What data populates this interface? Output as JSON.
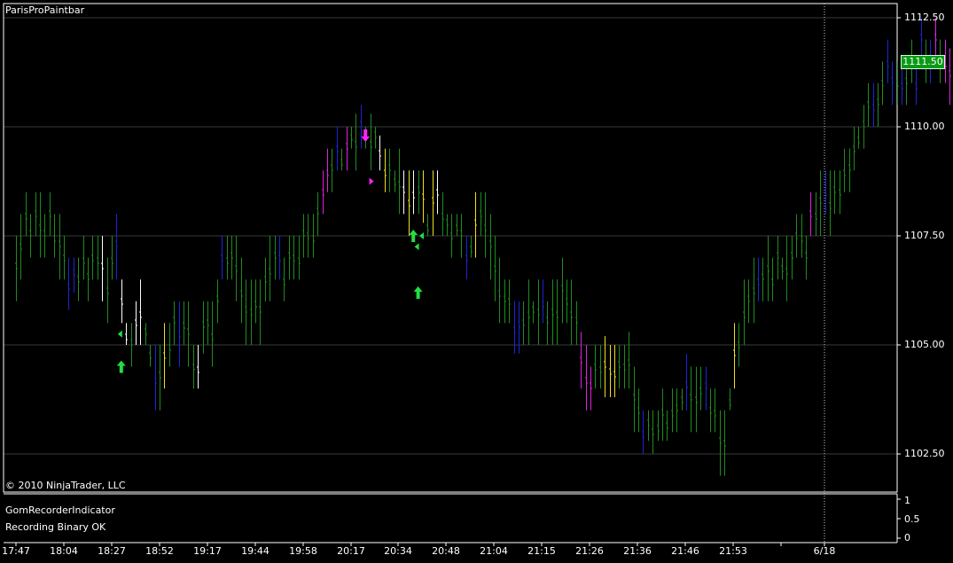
{
  "header": {
    "indicator_title": "ParisProPaintbar",
    "copyright": "© 2010 NinjaTrader, LLC"
  },
  "lower_panel": {
    "indicator_name": "GomRecorderIndicator",
    "status_text": "Recording Binary OK",
    "axis_labels": [
      "1",
      "0.5",
      "0"
    ]
  },
  "current_price": "1111.50",
  "chart_data": {
    "type": "bar",
    "style": "ohlc-price-bars",
    "title": "",
    "xlabel": "",
    "ylabel": "",
    "ylim": [
      1101.6,
      1112.9
    ],
    "grid": true,
    "y_ticks": [
      "1112.50",
      "1110.00",
      "1107.50",
      "1105.00",
      "1102.50"
    ],
    "x_ticks": [
      "17:47",
      "18:04",
      "18:27",
      "18:52",
      "19:17",
      "19:44",
      "19:58",
      "20:17",
      "20:34",
      "20:48",
      "21:04",
      "21:15",
      "21:26",
      "21:36",
      "21:46",
      "21:53",
      "6/18"
    ],
    "bar_colors": {
      "G": "#1e8c1e",
      "B": "#2222d8",
      "M": "#e020e0",
      "Y": "#f0e020",
      "W": "#ffffff"
    },
    "bars": [
      [
        "G",
        1107.5,
        1106.0
      ],
      [
        "G",
        1108.0,
        1106.5
      ],
      [
        "G",
        1108.5,
        1107.5
      ],
      [
        "G",
        1108.0,
        1107.0
      ],
      [
        "G",
        1108.5,
        1107.5
      ],
      [
        "G",
        1108.5,
        1107.0
      ],
      [
        "G",
        1108.0,
        1107.0
      ],
      [
        "G",
        1108.5,
        1107.5
      ],
      [
        "G",
        1108.0,
        1107.0
      ],
      [
        "G",
        1108.0,
        1106.5
      ],
      [
        "G",
        1107.5,
        1106.5
      ],
      [
        "B",
        1107.0,
        1105.8
      ],
      [
        "B",
        1107.0,
        1106.2
      ],
      [
        "G",
        1107.0,
        1106.0
      ],
      [
        "G",
        1107.5,
        1106.5
      ],
      [
        "G",
        1107.0,
        1106.0
      ],
      [
        "G",
        1107.5,
        1106.5
      ],
      [
        "G",
        1107.5,
        1106.5
      ],
      [
        "W",
        1107.5,
        1106.0
      ],
      [
        "G",
        1107.0,
        1105.5
      ],
      [
        "G",
        1107.5,
        1106.5
      ],
      [
        "B",
        1108.0,
        1106.5
      ],
      [
        "W",
        1106.5,
        1105.5
      ],
      [
        "W",
        1105.5,
        1105.0
      ],
      [
        "G",
        1105.5,
        1104.5
      ],
      [
        "W",
        1106.0,
        1105.0
      ],
      [
        "W",
        1106.5,
        1105.0
      ],
      [
        "G",
        1105.5,
        1105.0
      ],
      [
        "G",
        1105.0,
        1104.5
      ],
      [
        "B",
        1105.0,
        1103.5
      ],
      [
        "G",
        1105.0,
        1103.5
      ],
      [
        "Y",
        1105.5,
        1104.0
      ],
      [
        "G",
        1105.5,
        1104.5
      ],
      [
        "G",
        1106.0,
        1105.0
      ],
      [
        "B",
        1106.0,
        1104.5
      ],
      [
        "G",
        1106.0,
        1105.0
      ],
      [
        "G",
        1106.0,
        1104.5
      ],
      [
        "G",
        1105.0,
        1104.0
      ],
      [
        "W",
        1105.0,
        1104.0
      ],
      [
        "G",
        1106.0,
        1104.8
      ],
      [
        "G",
        1106.0,
        1105.0
      ],
      [
        "G",
        1106.0,
        1104.5
      ],
      [
        "G",
        1106.5,
        1105.5
      ],
      [
        "B",
        1107.5,
        1106.5
      ],
      [
        "G",
        1107.5,
        1106.5
      ],
      [
        "G",
        1107.5,
        1106.5
      ],
      [
        "G",
        1107.5,
        1106.0
      ],
      [
        "G",
        1107.0,
        1105.5
      ],
      [
        "G",
        1106.5,
        1105.0
      ],
      [
        "G",
        1106.5,
        1105.0
      ],
      [
        "G",
        1106.5,
        1105.5
      ],
      [
        "G",
        1106.5,
        1105.0
      ],
      [
        "G",
        1107.0,
        1106.0
      ],
      [
        "G",
        1107.5,
        1106.0
      ],
      [
        "G",
        1107.5,
        1106.5
      ],
      [
        "B",
        1107.5,
        1106.5
      ],
      [
        "G",
        1107.0,
        1106.0
      ],
      [
        "G",
        1107.5,
        1106.5
      ],
      [
        "G",
        1107.5,
        1106.5
      ],
      [
        "G",
        1107.5,
        1106.5
      ],
      [
        "G",
        1108.0,
        1107.0
      ],
      [
        "G",
        1108.0,
        1107.0
      ],
      [
        "G",
        1108.0,
        1107.0
      ],
      [
        "G",
        1108.5,
        1107.5
      ],
      [
        "M",
        1109.0,
        1108.0
      ],
      [
        "M",
        1109.5,
        1108.5
      ],
      [
        "G",
        1109.5,
        1108.5
      ],
      [
        "B",
        1110.0,
        1109.0
      ],
      [
        "G",
        1109.5,
        1109.0
      ],
      [
        "M",
        1110.0,
        1109.0
      ],
      [
        "G",
        1110.0,
        1109.5
      ],
      [
        "G",
        1110.3,
        1109.0
      ],
      [
        "B",
        1110.5,
        1109.5
      ],
      [
        "G",
        1110.0,
        1109.5
      ],
      [
        "G",
        1110.3,
        1109.0
      ],
      [
        "G",
        1110.0,
        1109.5
      ],
      [
        "W",
        1109.8,
        1109.0
      ],
      [
        "Y",
        1109.5,
        1108.5
      ],
      [
        "G",
        1109.5,
        1108.5
      ],
      [
        "G",
        1109.0,
        1108.5
      ],
      [
        "G",
        1109.5,
        1108.0
      ],
      [
        "W",
        1109.0,
        1108.0
      ],
      [
        "Y",
        1109.0,
        1107.5
      ],
      [
        "W",
        1109.0,
        1108.0
      ],
      [
        "G",
        1109.0,
        1108.0
      ],
      [
        "Y",
        1109.0,
        1107.8
      ],
      [
        "G",
        1108.0,
        1107.5
      ],
      [
        "Y",
        1109.0,
        1107.5
      ],
      [
        "W",
        1109.0,
        1108.0
      ],
      [
        "G",
        1108.5,
        1107.5
      ],
      [
        "G",
        1108.0,
        1107.5
      ],
      [
        "G",
        1108.0,
        1107.0
      ],
      [
        "G",
        1108.0,
        1107.5
      ],
      [
        "G",
        1108.0,
        1107.0
      ],
      [
        "B",
        1107.5,
        1106.5
      ],
      [
        "G",
        1107.5,
        1107.0
      ],
      [
        "Y",
        1108.5,
        1107.0
      ],
      [
        "G",
        1108.5,
        1107.5
      ],
      [
        "G",
        1108.5,
        1107.0
      ],
      [
        "G",
        1108.0,
        1106.5
      ],
      [
        "G",
        1107.5,
        1106.0
      ],
      [
        "G",
        1107.0,
        1105.5
      ],
      [
        "G",
        1106.5,
        1105.5
      ],
      [
        "G",
        1106.5,
        1105.5
      ],
      [
        "B",
        1106.0,
        1104.8
      ],
      [
        "B",
        1106.0,
        1104.8
      ],
      [
        "G",
        1106.0,
        1105.0
      ],
      [
        "G",
        1106.5,
        1105.0
      ],
      [
        "G",
        1106.0,
        1105.5
      ],
      [
        "G",
        1106.5,
        1105.0
      ],
      [
        "B",
        1106.5,
        1105.5
      ],
      [
        "G",
        1106.0,
        1105.0
      ],
      [
        "G",
        1106.5,
        1105.0
      ],
      [
        "G",
        1106.5,
        1105.0
      ],
      [
        "G",
        1107.0,
        1105.5
      ],
      [
        "G",
        1106.5,
        1105.5
      ],
      [
        "G",
        1106.5,
        1105.0
      ],
      [
        "G",
        1106.0,
        1105.0
      ],
      [
        "M",
        1105.3,
        1104.0
      ],
      [
        "M",
        1105.0,
        1103.5
      ],
      [
        "M",
        1104.5,
        1103.5
      ],
      [
        "G",
        1105.0,
        1104.0
      ],
      [
        "G",
        1105.0,
        1104.0
      ],
      [
        "Y",
        1105.2,
        1103.8
      ],
      [
        "Y",
        1105.0,
        1103.8
      ],
      [
        "Y",
        1105.0,
        1103.8
      ],
      [
        "G",
        1105.0,
        1104.0
      ],
      [
        "G",
        1105.0,
        1104.0
      ],
      [
        "G",
        1105.3,
        1104.0
      ],
      [
        "G",
        1104.5,
        1103.0
      ],
      [
        "G",
        1104.0,
        1103.0
      ],
      [
        "B",
        1103.5,
        1102.5
      ],
      [
        "G",
        1103.5,
        1102.8
      ],
      [
        "G",
        1103.5,
        1102.5
      ],
      [
        "G",
        1103.5,
        1102.8
      ],
      [
        "G",
        1104.0,
        1102.8
      ],
      [
        "G",
        1103.5,
        1102.8
      ],
      [
        "G",
        1104.0,
        1103.0
      ],
      [
        "G",
        1104.0,
        1103.0
      ],
      [
        "G",
        1104.0,
        1103.5
      ],
      [
        "B",
        1104.8,
        1103.5
      ],
      [
        "G",
        1104.5,
        1103.0
      ],
      [
        "G",
        1104.5,
        1103.0
      ],
      [
        "G",
        1104.5,
        1103.5
      ],
      [
        "B",
        1104.5,
        1103.5
      ],
      [
        "G",
        1104.0,
        1103.0
      ],
      [
        "G",
        1104.0,
        1103.0
      ],
      [
        "G",
        1103.5,
        1102.0
      ],
      [
        "G",
        1103.5,
        1102.0
      ],
      [
        "G",
        1104.0,
        1103.5
      ],
      [
        "Y",
        1105.5,
        1104.0
      ],
      [
        "G",
        1105.5,
        1104.5
      ],
      [
        "G",
        1106.5,
        1105.0
      ],
      [
        "G",
        1106.5,
        1105.5
      ],
      [
        "G",
        1107.0,
        1105.5
      ],
      [
        "B",
        1107.0,
        1106.0
      ],
      [
        "G",
        1107.0,
        1106.0
      ],
      [
        "G",
        1107.5,
        1106.0
      ],
      [
        "G",
        1107.0,
        1106.0
      ],
      [
        "G",
        1107.5,
        1106.5
      ],
      [
        "G",
        1107.0,
        1106.5
      ],
      [
        "G",
        1107.5,
        1106.0
      ],
      [
        "G",
        1107.5,
        1106.5
      ],
      [
        "G",
        1108.0,
        1107.0
      ],
      [
        "G",
        1108.0,
        1107.0
      ],
      [
        "G",
        1107.5,
        1106.5
      ],
      [
        "M",
        1108.5,
        1107.5
      ],
      [
        "G",
        1108.5,
        1107.5
      ],
      [
        "G",
        1109.0,
        1107.5
      ],
      [
        "B",
        1109.0,
        1108.0
      ],
      [
        "G",
        1109.0,
        1107.5
      ],
      [
        "G",
        1109.0,
        1108.0
      ],
      [
        "G",
        1109.0,
        1108.0
      ],
      [
        "G",
        1109.5,
        1108.5
      ],
      [
        "G",
        1109.5,
        1108.5
      ],
      [
        "G",
        1110.0,
        1109.0
      ],
      [
        "G",
        1110.0,
        1109.5
      ],
      [
        "G",
        1110.5,
        1109.5
      ],
      [
        "G",
        1111.0,
        1110.0
      ],
      [
        "B",
        1111.0,
        1110.0
      ],
      [
        "G",
        1111.0,
        1110.0
      ],
      [
        "G",
        1111.5,
        1110.5
      ],
      [
        "B",
        1112.0,
        1111.0
      ],
      [
        "B",
        1111.5,
        1110.5
      ],
      [
        "G",
        1111.5,
        1110.5
      ],
      [
        "B",
        1111.5,
        1110.5
      ],
      [
        "G",
        1111.5,
        1110.5
      ],
      [
        "G",
        1112.0,
        1111.0
      ],
      [
        "B",
        1111.5,
        1110.5
      ],
      [
        "B",
        1112.5,
        1111.5
      ],
      [
        "G",
        1112.0,
        1111.0
      ],
      [
        "B",
        1112.0,
        1111.0
      ],
      [
        "M",
        1112.5,
        1111.5
      ],
      [
        "G",
        1112.0,
        1111.0
      ],
      [
        "M",
        1112.0,
        1111.0
      ],
      [
        "M",
        1111.8,
        1110.5
      ],
      [
        "M",
        1111.5,
        1110.5
      ],
      [
        "G",
        1112.0,
        1110.5
      ],
      [
        "B",
        1112.0,
        1111.0
      ],
      [
        "G",
        1112.5,
        1111.5
      ],
      [
        "G",
        1112.0,
        1111.5
      ],
      [
        "G",
        1112.5,
        1111.5
      ],
      [
        "G",
        1112.0,
        1111.5
      ],
      [
        "G",
        1112.0,
        1111.0
      ],
      [
        "Y",
        1112.0,
        1110.5
      ],
      [
        "Y",
        1111.5,
        1110.5
      ],
      [
        "W",
        1112.0,
        1110.0
      ],
      [
        "W",
        1111.5,
        1109.5
      ],
      [
        "W",
        1111.5,
        1109.0
      ],
      [
        "W",
        1111.5,
        1109.8
      ],
      [
        "W",
        1111.5,
        1110.0
      ],
      [
        "W",
        1112.0,
        1110.3
      ]
    ],
    "annotations": [
      {
        "type": "up-arrow",
        "bar": 22,
        "price": 1104.5
      },
      {
        "type": "left-triangle",
        "bar": 22,
        "price": 1105.25
      },
      {
        "type": "down-arrow",
        "bar": 73,
        "price": 1109.8
      },
      {
        "type": "right-triangle",
        "bar": 74,
        "price": 1108.75
      },
      {
        "type": "up-arrow",
        "bar": 83,
        "price": 1107.5
      },
      {
        "type": "left-triangle",
        "bar": 84,
        "price": 1107.25
      },
      {
        "type": "left-triangle",
        "bar": 85,
        "price": 1107.5
      },
      {
        "type": "up-arrow",
        "bar": 84,
        "price": 1106.2
      }
    ]
  }
}
